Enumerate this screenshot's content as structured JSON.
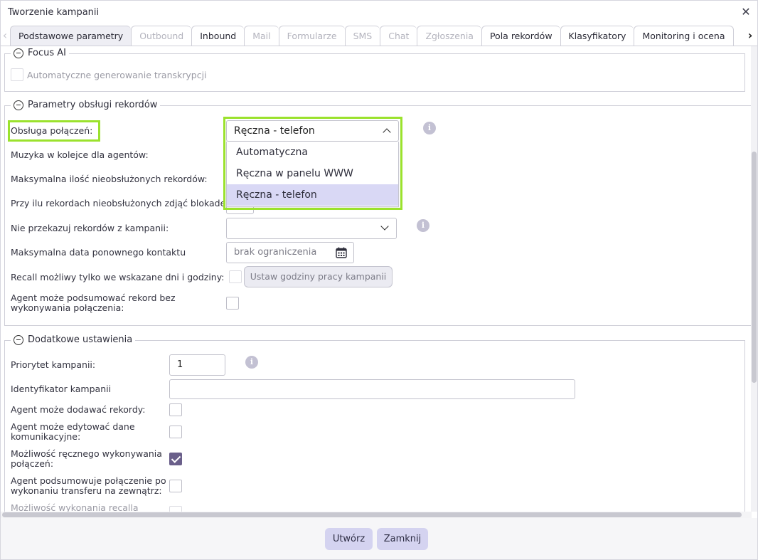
{
  "window": {
    "title": "Tworzenie kampanii"
  },
  "tabs": [
    {
      "label": "Podstawowe parametry",
      "state": "active"
    },
    {
      "label": "Outbound",
      "state": "disabled"
    },
    {
      "label": "Inbound",
      "state": "normal"
    },
    {
      "label": "Mail",
      "state": "disabled"
    },
    {
      "label": "Formularze",
      "state": "disabled"
    },
    {
      "label": "SMS",
      "state": "disabled"
    },
    {
      "label": "Chat",
      "state": "disabled"
    },
    {
      "label": "Zgłoszenia",
      "state": "disabled"
    },
    {
      "label": "Pola rekordów",
      "state": "normal"
    },
    {
      "label": "Klasyfikatory",
      "state": "normal"
    },
    {
      "label": "Monitoring i ocena",
      "state": "normal"
    }
  ],
  "focus_ai": {
    "title": "Focus AI",
    "transcription_label": "Automatyczne generowanie transkrypcji",
    "transcription_checked": false
  },
  "records": {
    "title": "Parametry obsługi rekordów",
    "call_handling_label": "Obsługa połączeń:",
    "call_handling_value": "Ręczna - telefon",
    "call_handling_options": [
      "Automatyczna",
      "Ręczna w panelu WWW",
      "Ręczna - telefon"
    ],
    "queue_music_label": "Muzyka w kolejce dla agentów:",
    "max_unhandled_label": "Maksymalna ilość nieobsłużonych rekordów:",
    "unlock_at_label": "Przy ilu rekordach nieobsłużonych zdjąć blokadę:",
    "no_transfer_label": "Nie przekazuj rekordów z kampanii:",
    "no_transfer_value": "",
    "max_date_label": "Maksymalna data ponownego kontaktu",
    "max_date_placeholder": "brak ograniczenia",
    "recall_label": "Recall możliwy tylko we wskazane dni i godziny:",
    "recall_checked": false,
    "work_hours_button": "Ustaw godziny pracy kampanii",
    "summarize_without_call_label_1": "Agent może podsumować rekord bez",
    "summarize_without_call_label_2": "wykonywania połączenia:",
    "summarize_without_call_checked": false
  },
  "extra": {
    "title": "Dodatkowe ustawienia",
    "priority_label": "Priorytet kampanii:",
    "priority_value": "1",
    "identifier_label": "Identyfikator kampanii",
    "identifier_value": "",
    "add_records_label": "Agent może dodawać rekordy:",
    "add_records_checked": false,
    "edit_contact_label_1": "Agent może edytować dane",
    "edit_contact_label_2": "komunikacyjne:",
    "edit_contact_checked": false,
    "manual_calls_label_1": "Możliwość ręcznego wykonywania",
    "manual_calls_label_2": "połączeń:",
    "manual_calls_checked": true,
    "summary_after_transfer_label_1": "Agent podsumowuje połączenie po",
    "summary_after_transfer_label_2": "wykonaniu transferu na zewnątrz:",
    "summary_after_transfer_checked": false,
    "recall_option_label": "Możliwość wykonania recalla"
  },
  "footer": {
    "create": "Utwórz",
    "close": "Zamknij"
  },
  "colors": {
    "highlight": "#9be22d",
    "accent_button": "#d4d3f0",
    "checkbox_checked": "#6a5f8a",
    "selected_option": "#d9d8f5"
  },
  "icons": {
    "close": "close-icon",
    "calendar": "calendar-icon",
    "info": "info-icon",
    "collapse": "minus-circle-icon"
  }
}
